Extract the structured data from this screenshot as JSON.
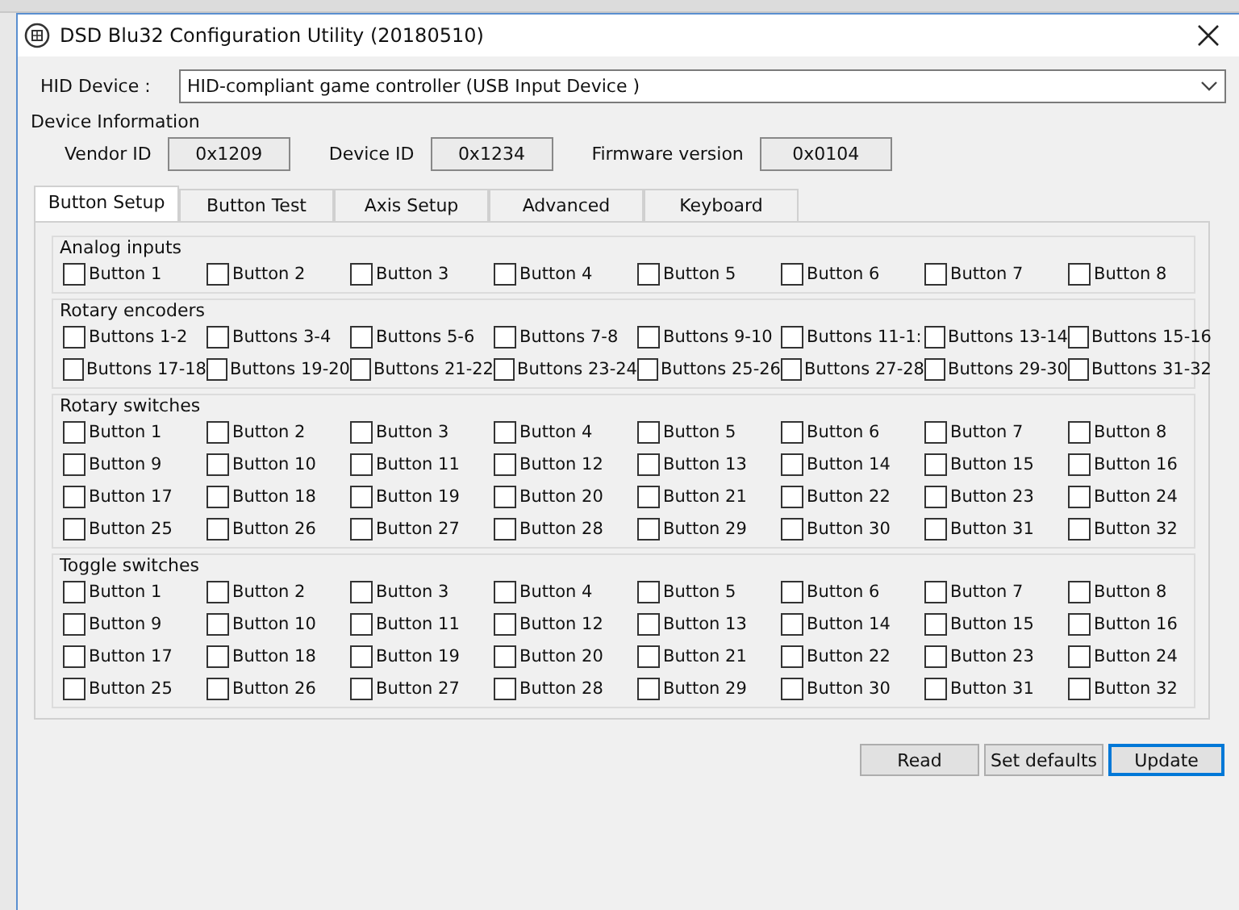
{
  "window": {
    "title": "DSD Blu32 Configuration Utility (20180510)"
  },
  "hid_device": {
    "label": "HID Device :",
    "value": "HID-compliant game controller (USB Input Device )"
  },
  "device_information": {
    "title": "Device Information",
    "fields": [
      {
        "label": "Vendor ID",
        "value": "0x1209"
      },
      {
        "label": "Device ID",
        "value": "0x1234"
      },
      {
        "label": "Firmware version",
        "value": "0x0104"
      }
    ]
  },
  "tabs": [
    {
      "label": "Button Setup",
      "selected": true
    },
    {
      "label": "Button Test",
      "selected": false
    },
    {
      "label": "Axis Setup",
      "selected": false
    },
    {
      "label": "Advanced",
      "selected": false
    },
    {
      "label": "Keyboard",
      "selected": false
    }
  ],
  "groups": [
    {
      "title": "Analog inputs",
      "items": [
        {
          "label": "Button 1",
          "checked": false
        },
        {
          "label": "Button 2",
          "checked": false
        },
        {
          "label": "Button 3",
          "checked": false
        },
        {
          "label": "Button 4",
          "checked": false
        },
        {
          "label": "Button 5",
          "checked": false
        },
        {
          "label": "Button 6",
          "checked": false
        },
        {
          "label": "Button 7",
          "checked": false
        },
        {
          "label": "Button 8",
          "checked": false
        }
      ]
    },
    {
      "title": "Rotary encoders",
      "items": [
        {
          "label": "Buttons 1-2",
          "checked": false
        },
        {
          "label": "Buttons 3-4",
          "checked": false
        },
        {
          "label": "Buttons 5-6",
          "checked": false
        },
        {
          "label": "Buttons 7-8",
          "checked": false
        },
        {
          "label": "Buttons 9-10",
          "checked": false
        },
        {
          "label": "Buttons 11-1:",
          "checked": false
        },
        {
          "label": "Buttons 13-14",
          "checked": false
        },
        {
          "label": "Buttons 15-16",
          "checked": false
        },
        {
          "label": "Buttons 17-18",
          "checked": false
        },
        {
          "label": "Buttons 19-20",
          "checked": false
        },
        {
          "label": "Buttons 21-22",
          "checked": false
        },
        {
          "label": "Buttons 23-24",
          "checked": false
        },
        {
          "label": "Buttons 25-26",
          "checked": false
        },
        {
          "label": "Buttons 27-28",
          "checked": false
        },
        {
          "label": "Buttons 29-30",
          "checked": false
        },
        {
          "label": "Buttons 31-32",
          "checked": false
        }
      ]
    },
    {
      "title": "Rotary switches",
      "items": [
        {
          "label": "Button 1",
          "checked": false
        },
        {
          "label": "Button 2",
          "checked": false
        },
        {
          "label": "Button 3",
          "checked": false
        },
        {
          "label": "Button 4",
          "checked": false
        },
        {
          "label": "Button 5",
          "checked": false
        },
        {
          "label": "Button 6",
          "checked": false
        },
        {
          "label": "Button 7",
          "checked": false
        },
        {
          "label": "Button 8",
          "checked": false
        },
        {
          "label": "Button 9",
          "checked": false
        },
        {
          "label": "Button 10",
          "checked": false
        },
        {
          "label": "Button 11",
          "checked": false
        },
        {
          "label": "Button 12",
          "checked": false
        },
        {
          "label": "Button 13",
          "checked": false
        },
        {
          "label": "Button 14",
          "checked": false
        },
        {
          "label": "Button 15",
          "checked": false
        },
        {
          "label": "Button 16",
          "checked": false
        },
        {
          "label": "Button 17",
          "checked": false
        },
        {
          "label": "Button 18",
          "checked": false
        },
        {
          "label": "Button 19",
          "checked": false
        },
        {
          "label": "Button 20",
          "checked": false
        },
        {
          "label": "Button 21",
          "checked": false
        },
        {
          "label": "Button 22",
          "checked": false
        },
        {
          "label": "Button 23",
          "checked": false
        },
        {
          "label": "Button 24",
          "checked": false
        },
        {
          "label": "Button 25",
          "checked": false
        },
        {
          "label": "Button 26",
          "checked": false
        },
        {
          "label": "Button 27",
          "checked": false
        },
        {
          "label": "Button 28",
          "checked": false
        },
        {
          "label": "Button 29",
          "checked": false
        },
        {
          "label": "Button 30",
          "checked": false
        },
        {
          "label": "Button 31",
          "checked": false
        },
        {
          "label": "Button 32",
          "checked": false
        }
      ]
    },
    {
      "title": "Toggle switches",
      "items": [
        {
          "label": "Button 1",
          "checked": false
        },
        {
          "label": "Button 2",
          "checked": false
        },
        {
          "label": "Button 3",
          "checked": false
        },
        {
          "label": "Button 4",
          "checked": false
        },
        {
          "label": "Button 5",
          "checked": false
        },
        {
          "label": "Button 6",
          "checked": false
        },
        {
          "label": "Button 7",
          "checked": false
        },
        {
          "label": "Button 8",
          "checked": false
        },
        {
          "label": "Button 9",
          "checked": false
        },
        {
          "label": "Button 10",
          "checked": false
        },
        {
          "label": "Button 11",
          "checked": false
        },
        {
          "label": "Button 12",
          "checked": false
        },
        {
          "label": "Button 13",
          "checked": false
        },
        {
          "label": "Button 14",
          "checked": false
        },
        {
          "label": "Button 15",
          "checked": false
        },
        {
          "label": "Button 16",
          "checked": false
        },
        {
          "label": "Button 17",
          "checked": false
        },
        {
          "label": "Button 18",
          "checked": false
        },
        {
          "label": "Button 19",
          "checked": false
        },
        {
          "label": "Button 20",
          "checked": false
        },
        {
          "label": "Button 21",
          "checked": false
        },
        {
          "label": "Button 22",
          "checked": false
        },
        {
          "label": "Button 23",
          "checked": false
        },
        {
          "label": "Button 24",
          "checked": false
        },
        {
          "label": "Button 25",
          "checked": false
        },
        {
          "label": "Button 26",
          "checked": false
        },
        {
          "label": "Button 27",
          "checked": false
        },
        {
          "label": "Button 28",
          "checked": false
        },
        {
          "label": "Button 29",
          "checked": false
        },
        {
          "label": "Button 30",
          "checked": false
        },
        {
          "label": "Button 31",
          "checked": false
        },
        {
          "label": "Button 32",
          "checked": false
        }
      ]
    }
  ],
  "buttons": [
    {
      "label": "Read",
      "kind": "normal"
    },
    {
      "label": "Set defaults",
      "kind": "normal"
    },
    {
      "label": "Update",
      "kind": "default"
    }
  ]
}
